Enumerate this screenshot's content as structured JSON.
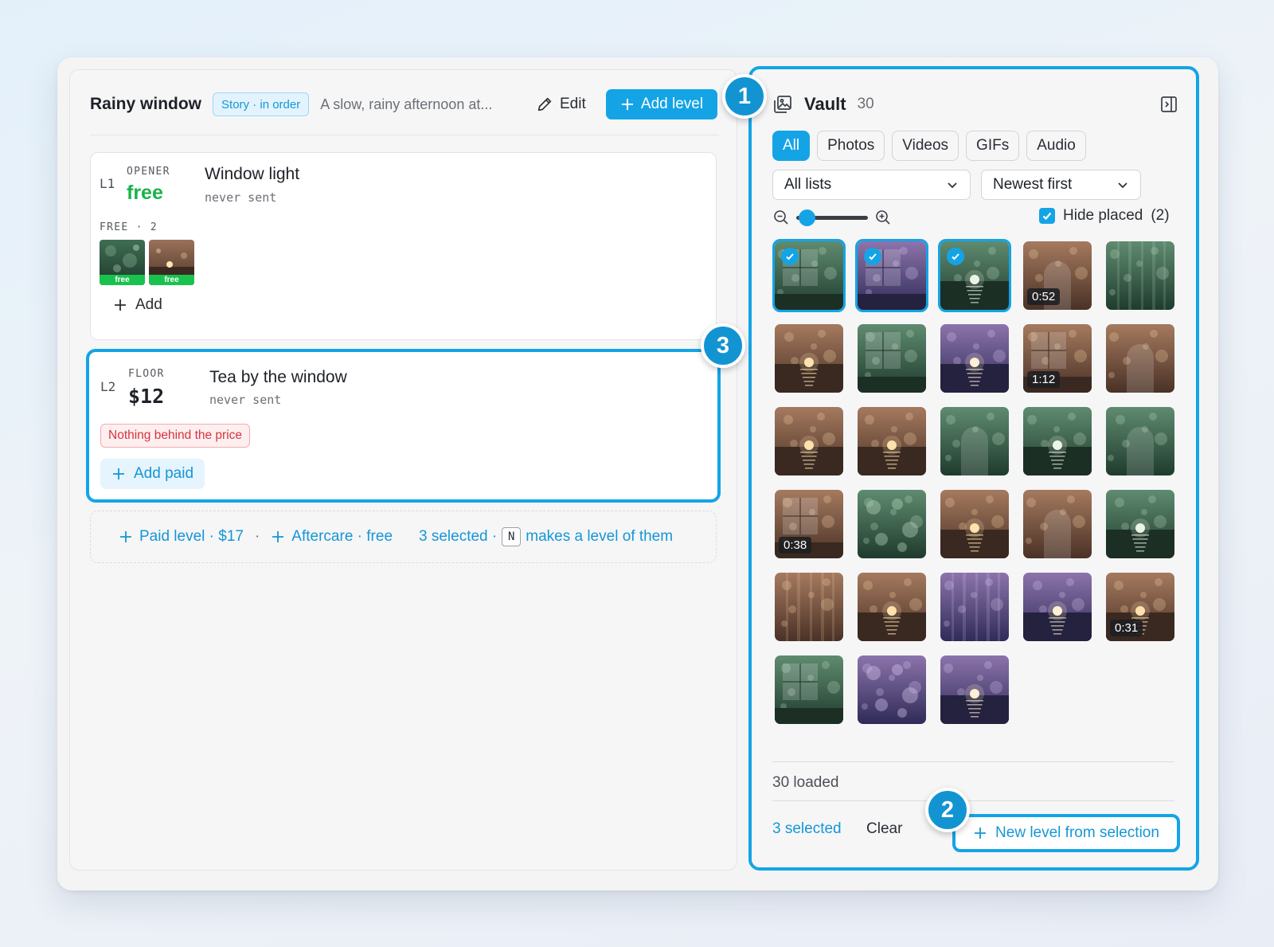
{
  "story": {
    "title": "Rainy window",
    "badge": "Story · in order",
    "description": "A slow, rainy afternoon at...",
    "edit_label": "Edit",
    "add_level_label": "Add level"
  },
  "levels": [
    {
      "tag": "L1",
      "kind": "OPENER",
      "price": "free",
      "title": "Window light",
      "status": "never sent",
      "items_label": "FREE · 2",
      "thumb_tags": [
        "free",
        "free"
      ],
      "add_label": "Add"
    },
    {
      "tag": "L2",
      "kind": "FLOOR",
      "price": "$12",
      "title": "Tea by the window",
      "status": "never sent",
      "warning": "Nothing behind the price",
      "add_label": "Add paid"
    }
  ],
  "suggestions": {
    "paid": "Paid level · $17",
    "sep": "·",
    "aftercare": "Aftercare · free",
    "selected_prefix": "3 selected ·",
    "key": "N",
    "selected_suffix": "makes a level of them"
  },
  "vault": {
    "title": "Vault",
    "count": "30",
    "filters": [
      "All",
      "Photos",
      "Videos",
      "GIFs",
      "Audio"
    ],
    "active_filter": "All",
    "list_select": "All lists",
    "sort_select": "Newest first",
    "zoom_level": 0.1,
    "hide_placed_label": "Hide placed",
    "hide_placed_count": "(2)",
    "hide_placed_checked": true,
    "loaded": "30 loaded",
    "selected_count": "3 selected",
    "clear_label": "Clear",
    "new_level_label": "New level from selection",
    "items": [
      {
        "palette": "green",
        "scene": "window",
        "selected": true
      },
      {
        "palette": "purple",
        "scene": "window",
        "selected": true
      },
      {
        "palette": "green",
        "scene": "sunset",
        "selected": true
      },
      {
        "palette": "brown",
        "scene": "arch",
        "duration": "0:52"
      },
      {
        "palette": "green",
        "scene": "streaks"
      },
      {
        "palette": "brown",
        "scene": "sunset"
      },
      {
        "palette": "green",
        "scene": "window"
      },
      {
        "palette": "purple",
        "scene": "sunset"
      },
      {
        "palette": "brown",
        "scene": "window",
        "duration": "1:12"
      },
      {
        "palette": "brown",
        "scene": "arch"
      },
      {
        "palette": "brown",
        "scene": "sunset"
      },
      {
        "palette": "brown",
        "scene": "sunset"
      },
      {
        "palette": "green",
        "scene": "arch"
      },
      {
        "palette": "green",
        "scene": "sunset"
      },
      {
        "palette": "green",
        "scene": "arch"
      },
      {
        "palette": "brown",
        "scene": "window",
        "duration": "0:38"
      },
      {
        "palette": "green",
        "scene": "bokeh"
      },
      {
        "palette": "brown",
        "scene": "sunset"
      },
      {
        "palette": "brown",
        "scene": "arch"
      },
      {
        "palette": "green",
        "scene": "sunset"
      },
      {
        "palette": "brown",
        "scene": "streaks"
      },
      {
        "palette": "brown",
        "scene": "sunset"
      },
      {
        "palette": "purple",
        "scene": "streaks"
      },
      {
        "palette": "purple",
        "scene": "sunset"
      },
      {
        "palette": "brown",
        "scene": "sunset",
        "duration": "0:31"
      },
      {
        "palette": "green",
        "scene": "window"
      },
      {
        "palette": "purple",
        "scene": "bokeh"
      },
      {
        "palette": "purple",
        "scene": "sunset"
      }
    ]
  },
  "markers": [
    "1",
    "2",
    "3"
  ],
  "colors": {
    "accent": "#14a4e6",
    "free_green": "#19b34a",
    "warning_red": "#d8343d"
  }
}
